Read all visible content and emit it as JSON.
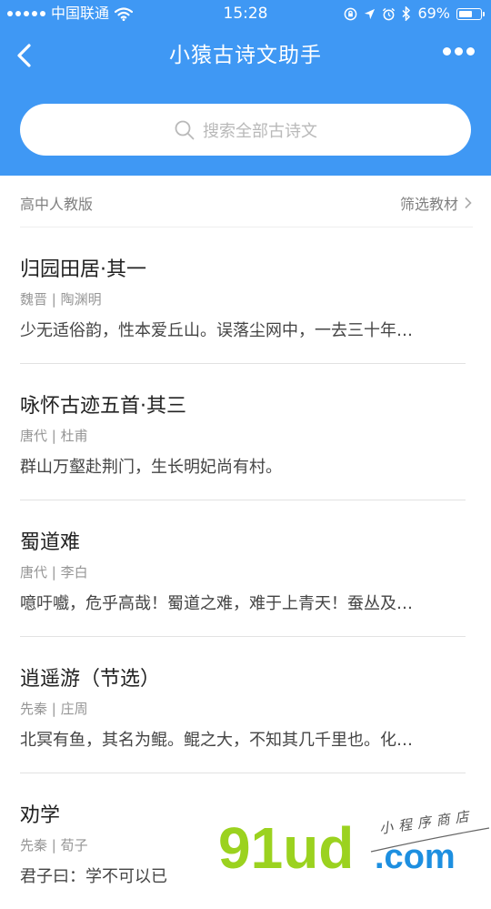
{
  "status": {
    "carrier": "中国联通",
    "time": "15:28",
    "battery": "69%",
    "battery_level": 0.69
  },
  "nav": {
    "title": "小猿古诗文助手"
  },
  "search": {
    "placeholder": "搜索全部古诗文"
  },
  "filter": {
    "edition": "高中人教版",
    "button_label": "筛选教材"
  },
  "poems": [
    {
      "title": "归园田居·其一",
      "meta": "魏晋 | 陶渊明",
      "excerpt": "少无适俗韵，性本爱丘山。误落尘网中，一去三十年…"
    },
    {
      "title": "咏怀古迹五首·其三",
      "meta": "唐代 | 杜甫",
      "excerpt": "群山万壑赴荆门，生长明妃尚有村。"
    },
    {
      "title": "蜀道难",
      "meta": "唐代 | 李白",
      "excerpt": "噫吁嚱，危乎高哉！蜀道之难，难于上青天！蚕丛及…"
    },
    {
      "title": "逍遥游（节选）",
      "meta": "先秦 | 庄周",
      "excerpt": "北冥有鱼，其名为鲲。鲲之大，不知其几千里也。化…"
    },
    {
      "title": "劝学",
      "meta": "先秦 | 荀子",
      "excerpt": "君子曰：学不可以已"
    }
  ],
  "watermark": {
    "logo": "91ud",
    "domain": ".com",
    "tagline": "小程序商店"
  },
  "colors": {
    "header": "#3f98f4",
    "watermark_green": "#9bd21f",
    "watermark_blue": "#1d8fe0"
  }
}
